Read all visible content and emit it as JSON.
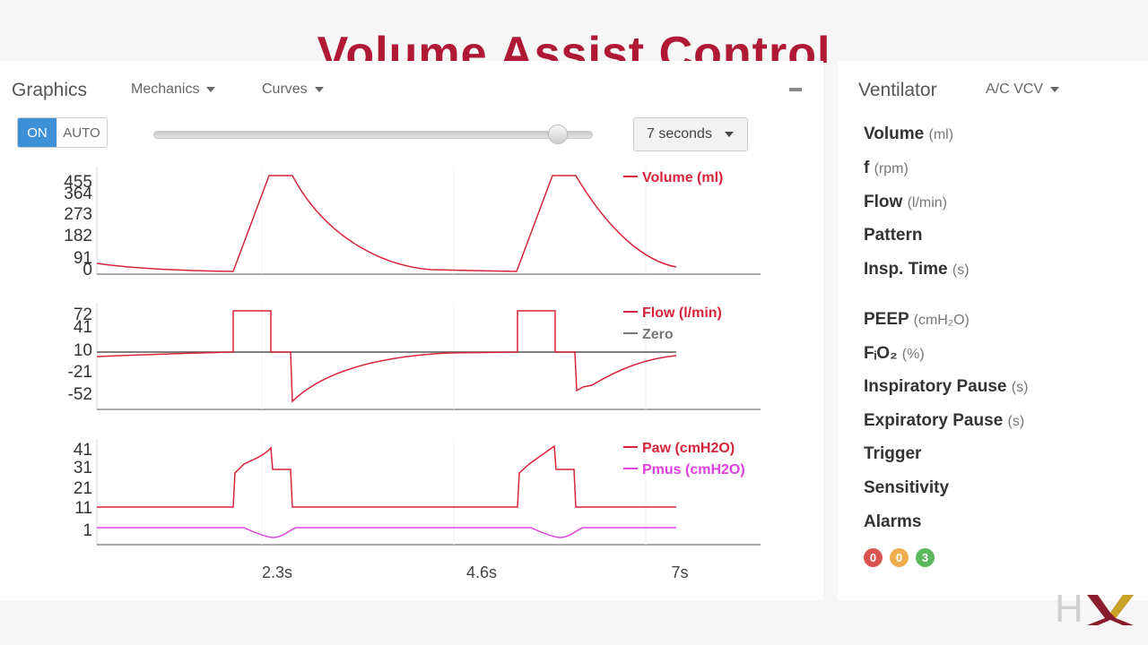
{
  "slide_title": "Volume Assist Control",
  "graphics": {
    "title": "Graphics",
    "menu_mechanics": "Mechanics",
    "menu_curves": "Curves",
    "toggle_on": "ON",
    "toggle_auto": "AUTO",
    "time_window": "7 seconds",
    "slider_value_fraction": 0.94,
    "x_ticks": [
      "2.3s",
      "4.6s",
      "7s"
    ]
  },
  "chart_data": [
    {
      "type": "line",
      "series": [
        {
          "name": "Volume (ml)",
          "color": "#d6243c"
        }
      ],
      "yticks": [
        "455",
        "364",
        "273",
        "182",
        "91",
        "0"
      ],
      "ylim": [
        0,
        480
      ]
    },
    {
      "type": "line",
      "series": [
        {
          "name": "Flow (l/min)",
          "color": "#d6243c"
        },
        {
          "name": "Zero",
          "color": "#777777"
        }
      ],
      "yticks": [
        "72",
        "41",
        "10",
        "-21",
        "-52"
      ],
      "ylim": [
        -60,
        80
      ]
    },
    {
      "type": "line",
      "series": [
        {
          "name": "Paw (cmH2O)",
          "color": "#d6243c"
        },
        {
          "name": "Pmus (cmH2O)",
          "color": "#e040e0"
        }
      ],
      "yticks": [
        "41",
        "31",
        "21",
        "11",
        "1"
      ],
      "ylim": [
        -5,
        45
      ]
    }
  ],
  "ventilator": {
    "title": "Ventilator",
    "mode": "A/C VCV",
    "params": [
      {
        "label": "Volume",
        "unit": "(ml)"
      },
      {
        "label": "f",
        "unit": "(rpm)"
      },
      {
        "label": "Flow",
        "unit": "(l/min)"
      },
      {
        "label": "Pattern",
        "unit": ""
      },
      {
        "label": "Insp. Time",
        "unit": "(s)"
      },
      {
        "label": "PEEP",
        "unit": "(cmH₂O)"
      },
      {
        "label": "FᵢO₂",
        "unit": "(%)"
      },
      {
        "label": "Inspiratory Pause",
        "unit": "(s)"
      },
      {
        "label": "Expiratory Pause",
        "unit": "(s)"
      },
      {
        "label": "Trigger",
        "unit": ""
      },
      {
        "label": "Sensitivity",
        "unit": ""
      },
      {
        "label": "Alarms",
        "unit": ""
      }
    ],
    "alarms": [
      {
        "count": "0",
        "color": "#d9534f"
      },
      {
        "count": "0",
        "color": "#f0ad4e"
      },
      {
        "count": "3",
        "color": "#5cb85c"
      }
    ]
  },
  "logo_text": "HX"
}
